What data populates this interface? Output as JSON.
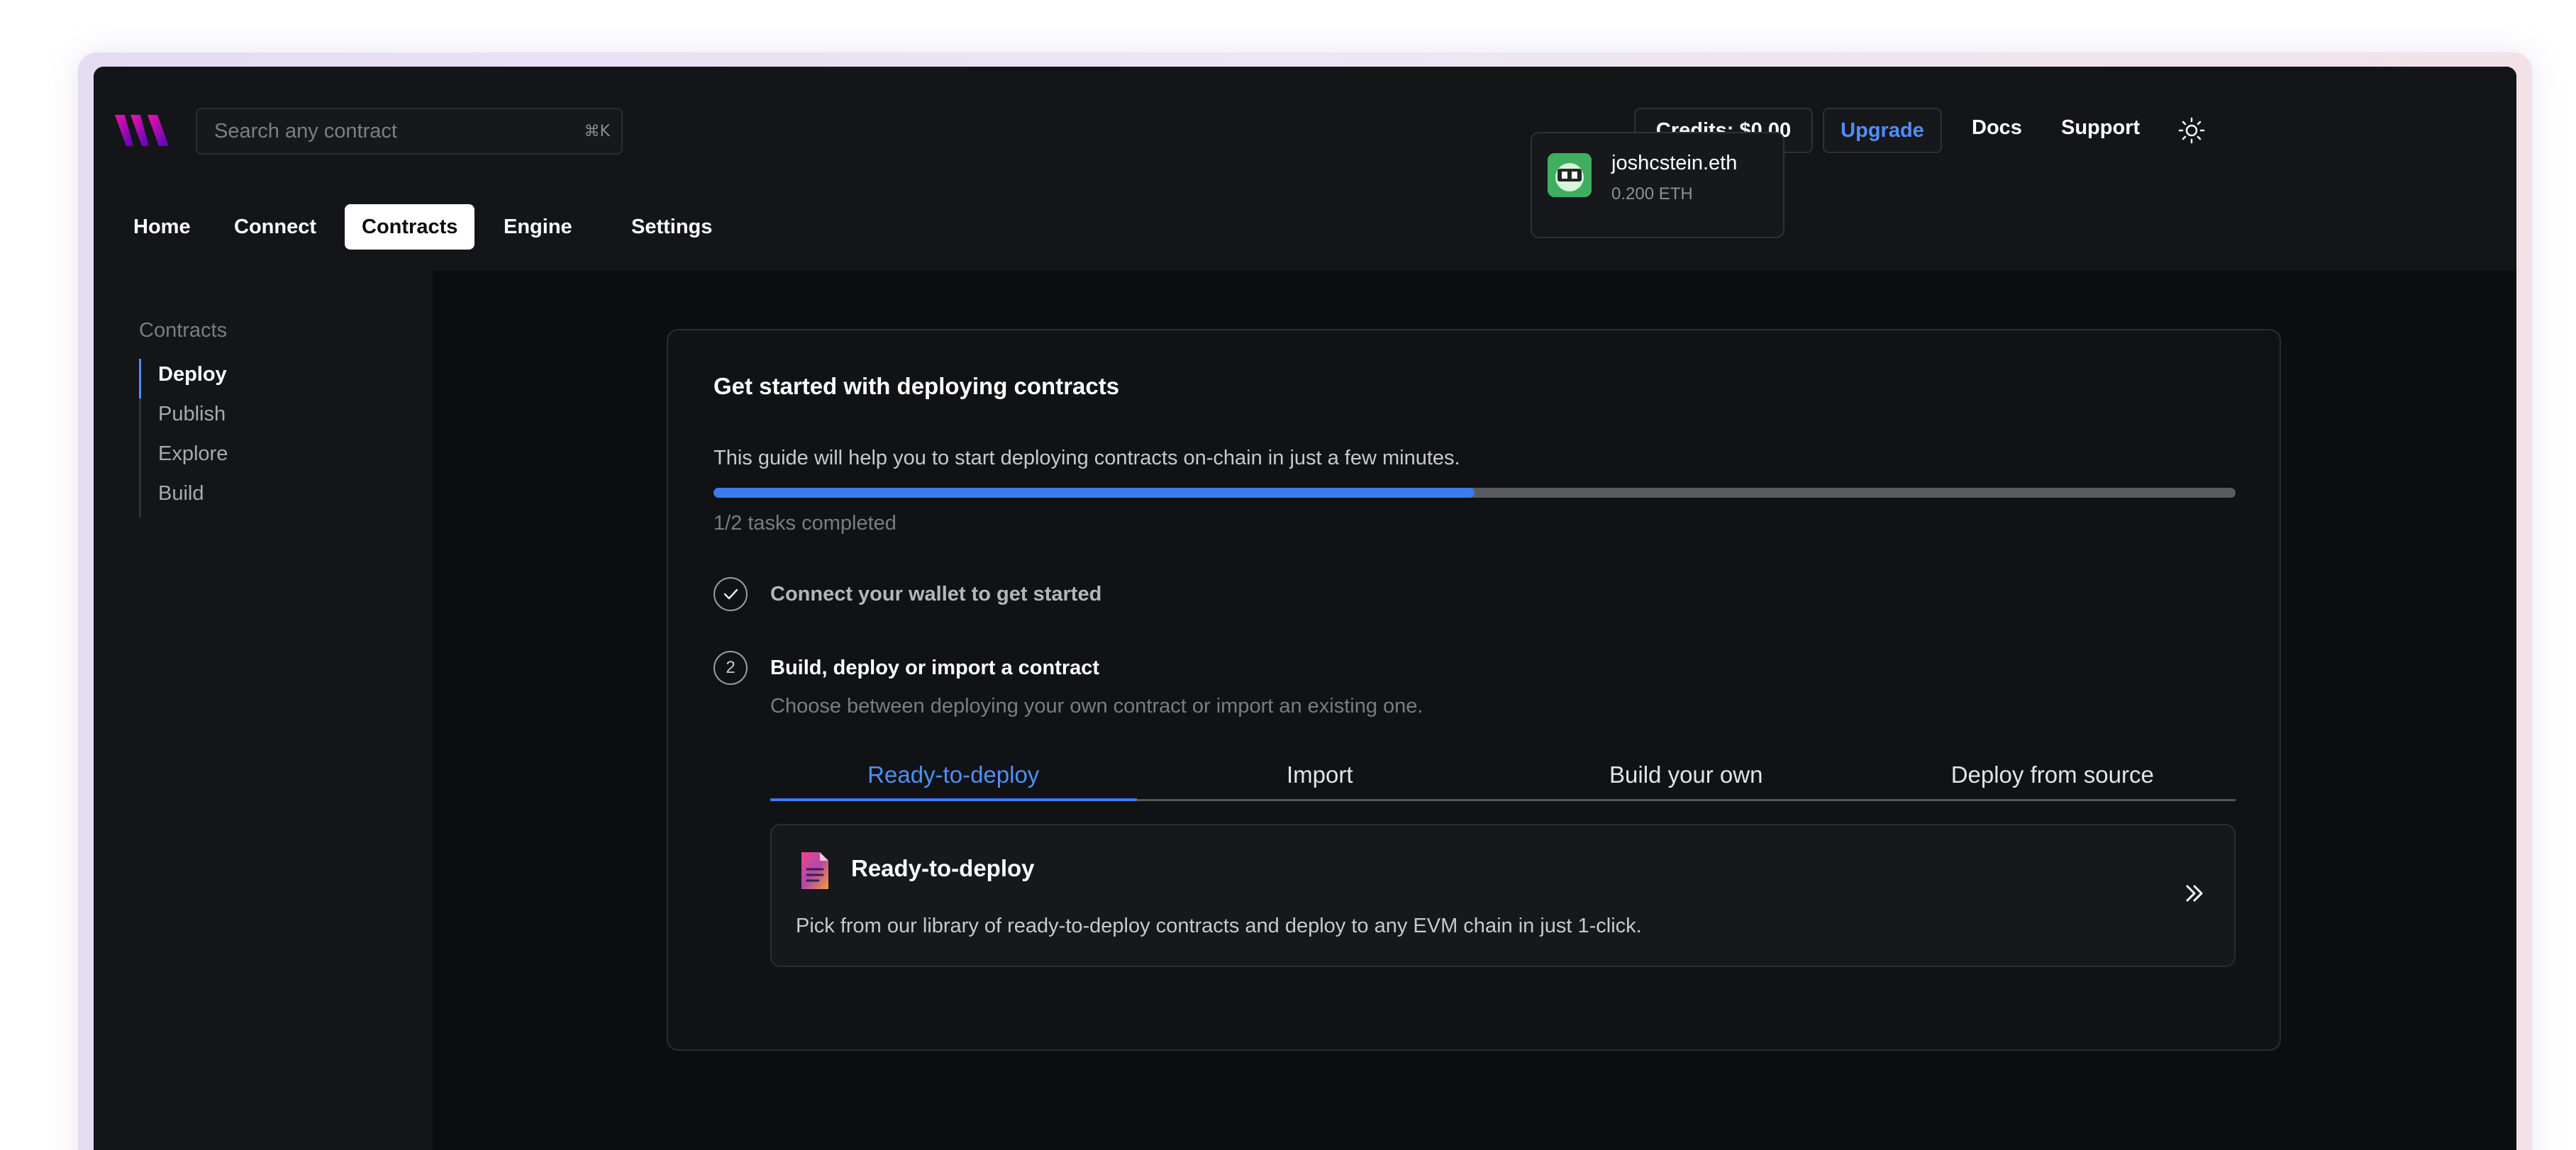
{
  "header": {
    "search_placeholder": "Search any contract",
    "search_shortcut": "⌘K",
    "credits": "Credits: $0.00",
    "upgrade": "Upgrade",
    "docs": "Docs",
    "support": "Support",
    "account": {
      "name": "joshcstein.eth",
      "balance": "0.200 ETH"
    }
  },
  "nav": {
    "items": [
      {
        "label": "Home"
      },
      {
        "label": "Connect"
      },
      {
        "label": "Contracts"
      },
      {
        "label": "Engine"
      },
      {
        "label": "Settings"
      }
    ],
    "active": "Contracts"
  },
  "sidebar": {
    "heading": "Contracts",
    "items": [
      {
        "label": "Deploy"
      },
      {
        "label": "Publish"
      },
      {
        "label": "Explore"
      },
      {
        "label": "Build"
      }
    ],
    "active": "Deploy"
  },
  "guide": {
    "title": "Get started with deploying contracts",
    "subtitle": "This guide will help you to start deploying contracts on-chain in just a few minutes.",
    "progress_fraction": 0.5,
    "tasks_status": "1/2 tasks completed",
    "steps": [
      {
        "title": "Connect your wallet to get started",
        "done": true
      },
      {
        "number": "2",
        "title": "Build, deploy or import a contract",
        "description": "Choose between deploying your own contract or import an existing one."
      }
    ],
    "tabs": [
      {
        "label": "Ready-to-deploy"
      },
      {
        "label": "Import"
      },
      {
        "label": "Build your own"
      },
      {
        "label": "Deploy from source"
      }
    ],
    "active_tab": "Ready-to-deploy",
    "option": {
      "title": "Ready-to-deploy",
      "description": "Pick from our library of ready-to-deploy contracts and deploy to any EVM chain in just 1-click."
    }
  },
  "colors": {
    "accent": "#3b7bef",
    "background": "#0c0d10",
    "panel": "#141519"
  }
}
